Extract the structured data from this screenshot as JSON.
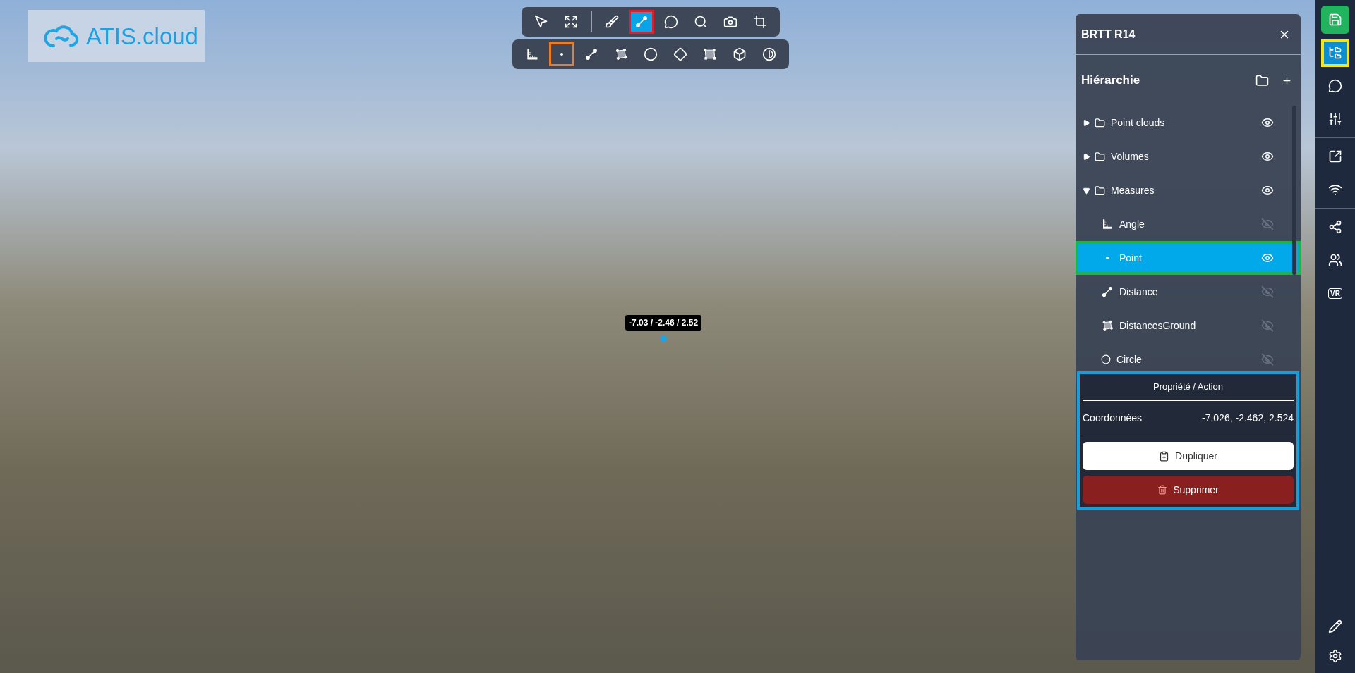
{
  "logo": {
    "text": "ATIS.cloud"
  },
  "toolbar": {
    "main_tools": [
      {
        "kind": "navigate",
        "selected": false
      },
      {
        "kind": "fit",
        "selected": false
      },
      {
        "kind": "divider"
      },
      {
        "kind": "paint",
        "selected": false
      },
      {
        "kind": "measure",
        "selected": true,
        "color": "#e11d2a"
      },
      {
        "kind": "comment",
        "selected": false
      },
      {
        "kind": "search",
        "selected": false
      },
      {
        "kind": "camera",
        "selected": false
      },
      {
        "kind": "crop",
        "selected": false
      }
    ],
    "measure_tools": [
      {
        "kind": "angle",
        "selected": false
      },
      {
        "kind": "point",
        "selected": false,
        "color": "#f07c1e"
      },
      {
        "kind": "distance",
        "selected": false
      },
      {
        "kind": "polygon",
        "selected": false
      },
      {
        "kind": "circle",
        "selected": false
      },
      {
        "kind": "diamond",
        "selected": false
      },
      {
        "kind": "area",
        "selected": false
      },
      {
        "kind": "volume",
        "selected": false
      },
      {
        "kind": "contrast",
        "selected": false
      }
    ]
  },
  "viewport": {
    "marker_label": "-7.03 / -2.46 / 2.52"
  },
  "panel": {
    "title": "BRTT R14",
    "hierarchy": {
      "title": "Hiérarchie",
      "items": [
        {
          "label": "Point clouds",
          "expanded": false,
          "visible": true,
          "selected": false
        },
        {
          "label": "Volumes",
          "expanded": false,
          "visible": true,
          "selected": false
        },
        {
          "label": "Measures",
          "expanded": true,
          "visible": true,
          "selected": false,
          "children": [
            {
              "kind": "angle",
              "label": "Angle",
              "visible": false,
              "selected": false
            },
            {
              "kind": "point",
              "label": "Point",
              "visible": true,
              "selected": true,
              "color": "#22b24c"
            },
            {
              "kind": "distance",
              "label": "Distance",
              "visible": false,
              "selected": false
            },
            {
              "kind": "polygon",
              "label": "DistancesGround",
              "visible": false,
              "selected": false
            },
            {
              "kind": "circle",
              "label": "Circle",
              "visible": false,
              "selected": false
            }
          ]
        }
      ]
    },
    "properties": {
      "title": "Propriété / Action",
      "color": "#129fdc",
      "rows": [
        {
          "label": "Coordonnées",
          "value": "-7.026, -2.462, 2.524"
        }
      ],
      "buttons": [
        {
          "kind": "duplicate",
          "label": "Dupliquer"
        },
        {
          "kind": "delete",
          "label": "Supprimer"
        }
      ]
    }
  },
  "sidebar": {
    "groups": [
      [
        {
          "kind": "save",
          "selected": false
        },
        {
          "kind": "hierarchy",
          "selected": true,
          "color": "#f4e419"
        },
        {
          "kind": "comments",
          "selected": false
        },
        {
          "kind": "settings",
          "selected": false
        }
      ],
      [
        {
          "kind": "open-external",
          "selected": false
        },
        {
          "kind": "wifi",
          "selected": false
        }
      ],
      [
        {
          "kind": "share",
          "selected": false
        },
        {
          "kind": "users",
          "selected": false
        },
        {
          "kind": "vr",
          "label": "VR",
          "selected": false
        }
      ]
    ],
    "bottom": [
      {
        "kind": "edit",
        "selected": false
      },
      {
        "kind": "gear",
        "selected": false
      }
    ]
  }
}
